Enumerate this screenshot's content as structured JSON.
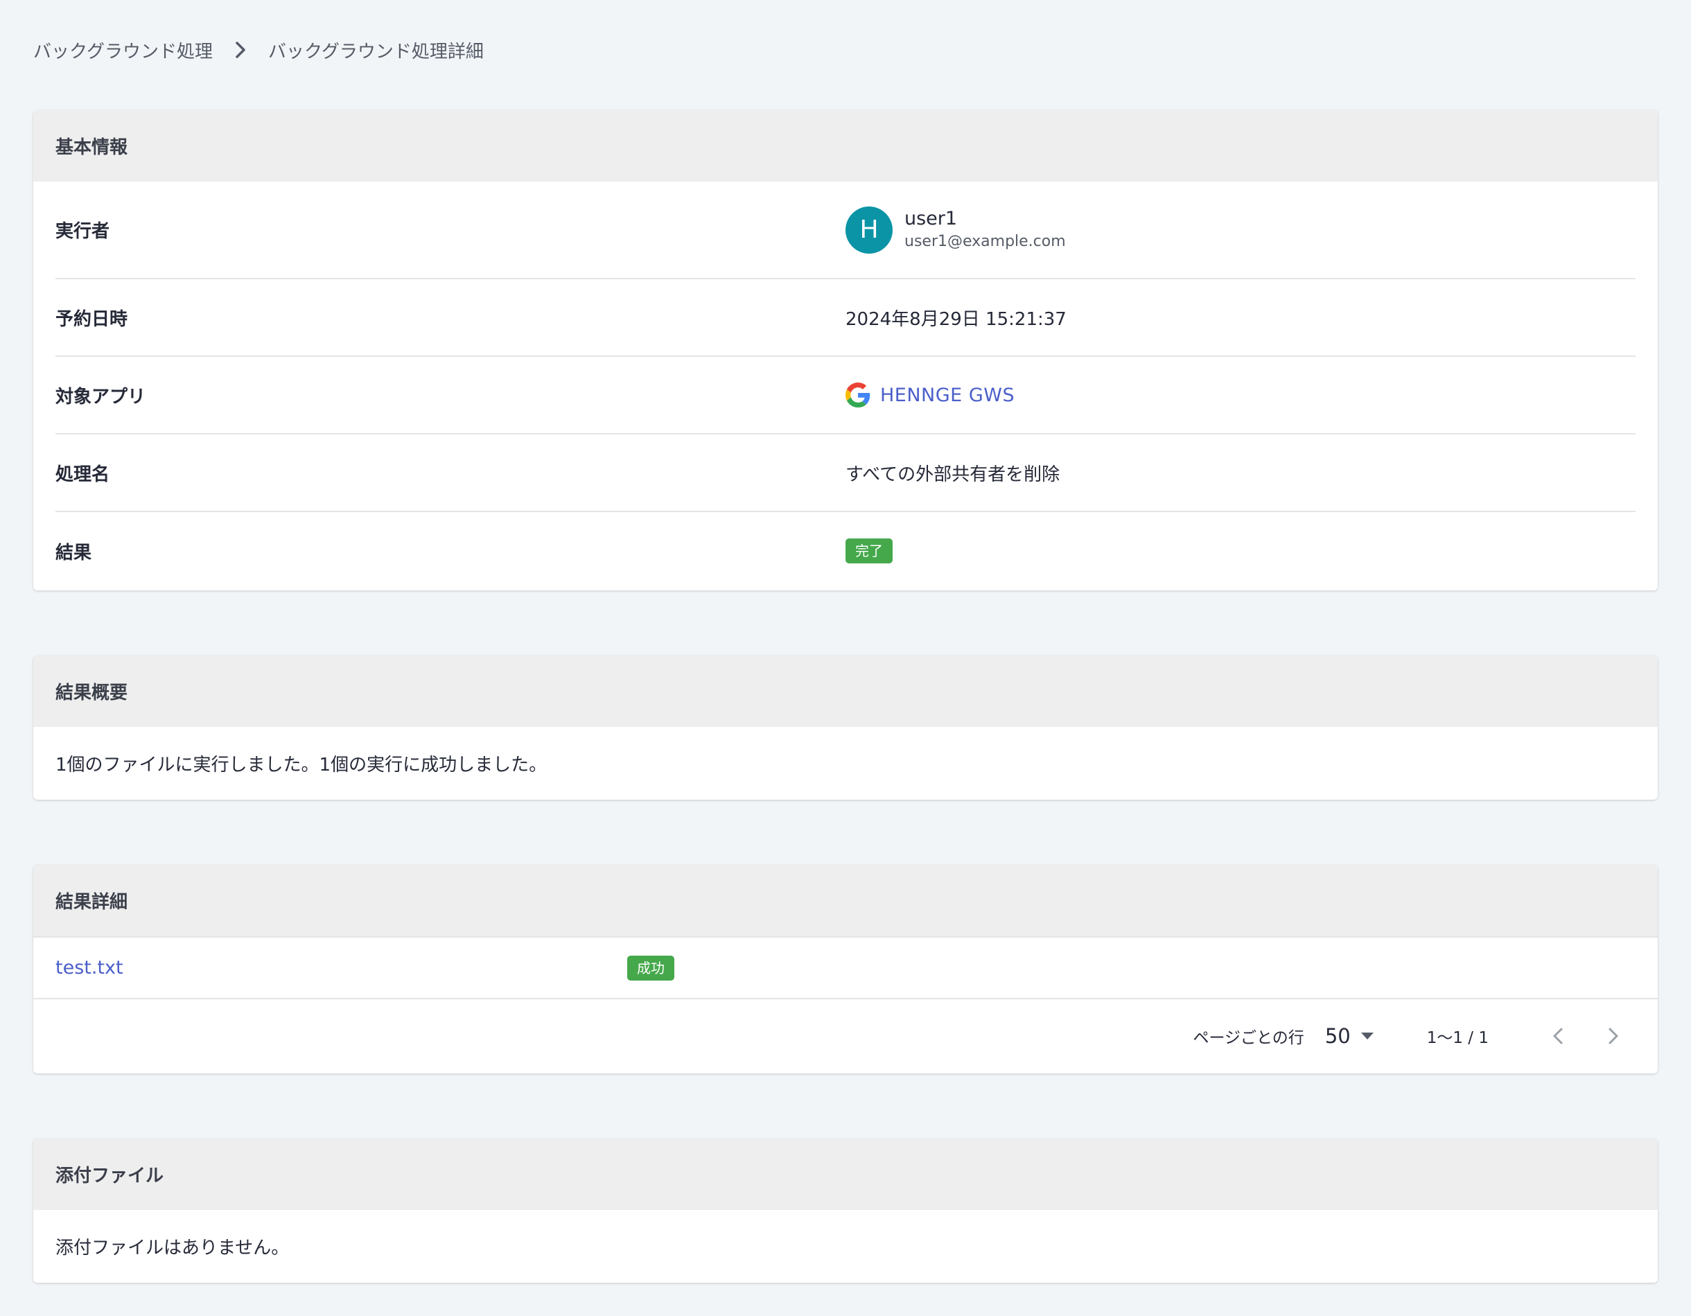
{
  "breadcrumb": {
    "parent": "バックグラウンド処理",
    "current": "バックグラウンド処理詳細"
  },
  "basic_info": {
    "title": "基本情報",
    "executor_label": "実行者",
    "executor": {
      "avatar_initial": "H",
      "avatar_color": "#0a94a6",
      "name": "user1",
      "email": "user1@example.com"
    },
    "scheduled_label": "予約日時",
    "scheduled_value": "2024年8月29日 15:21:37",
    "target_app_label": "対象アプリ",
    "target_app": {
      "icon": "google-icon",
      "name": "HENNGE GWS"
    },
    "process_label": "処理名",
    "process_value": "すべての外部共有者を削除",
    "result_label": "結果",
    "result_badge": "完了"
  },
  "summary": {
    "title": "結果概要",
    "text": "1個のファイルに実行しました。1個の実行に成功しました。"
  },
  "details": {
    "title": "結果詳細",
    "rows": [
      {
        "file": "test.txt",
        "status": "成功"
      }
    ],
    "pager": {
      "rows_per_page_label": "ページごとの行",
      "rows_per_page": "50",
      "range": "1〜1 / 1"
    }
  },
  "attachments": {
    "title": "添付ファイル",
    "text": "添付ファイルはありません。"
  },
  "colors": {
    "accent_link": "#4b5fc9",
    "success_badge": "#45a84b",
    "page_background": "#f2f5f8"
  }
}
